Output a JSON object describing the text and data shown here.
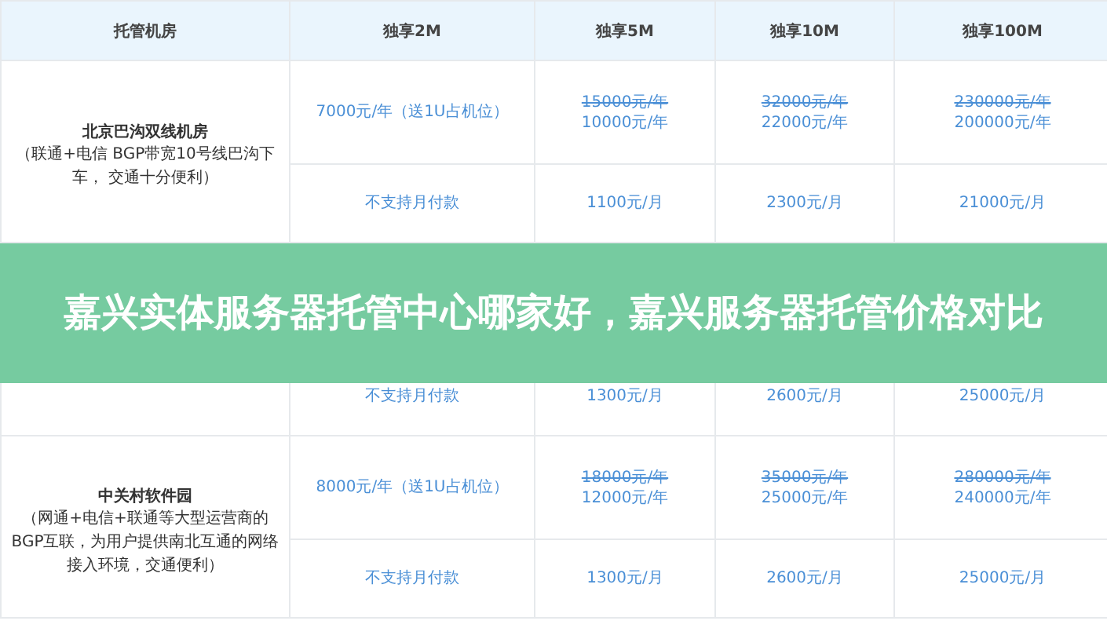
{
  "table": {
    "columns": [
      "托管机房",
      "独享2M",
      "独享5M",
      "独享10M",
      "独享100M"
    ],
    "rows": [
      {
        "room": {
          "name": "北京巴沟双线机房",
          "description": "（联通+电信 BGP带宽10号线巴沟下车， 交通十分便利）"
        },
        "annual": [
          {
            "kind": "plain",
            "text": "7000元/年（送1U占机位）"
          },
          {
            "kind": "discounted",
            "old": "15000元/年",
            "new": "10000元/年"
          },
          {
            "kind": "discounted",
            "old": "32000元/年",
            "new": "22000元/年"
          },
          {
            "kind": "discounted",
            "old": "230000元/年",
            "new": "200000元/年"
          }
        ],
        "monthly": [
          "不支持月付款",
          "1100元/月",
          "2300元/月",
          "21000元/月"
        ]
      },
      {
        "annual": [],
        "monthly": [
          "不支持月付款",
          "1300元/月",
          "2600元/月",
          "25000元/月"
        ]
      },
      {
        "room": {
          "name": "中关村软件园",
          "description": "（网通+电信+联通等大型运营商的BGP互联，为用户提供南北互通的网络接入环境，交通便利）"
        },
        "annual": [
          {
            "kind": "plain",
            "text": "8000元/年（送1U占机位）"
          },
          {
            "kind": "discounted",
            "old": "18000元/年",
            "new": "12000元/年"
          },
          {
            "kind": "discounted",
            "old": "35000元/年",
            "new": "25000元/年"
          },
          {
            "kind": "discounted",
            "old": "280000元/年",
            "new": "240000元/年"
          }
        ],
        "monthly": [
          "不支持月付款",
          "1300元/月",
          "2600元/月",
          "25000元/月"
        ]
      }
    ]
  },
  "banner": {
    "title": "嘉兴实体服务器托管中心哪家好，嘉兴服务器托管价格对比"
  }
}
